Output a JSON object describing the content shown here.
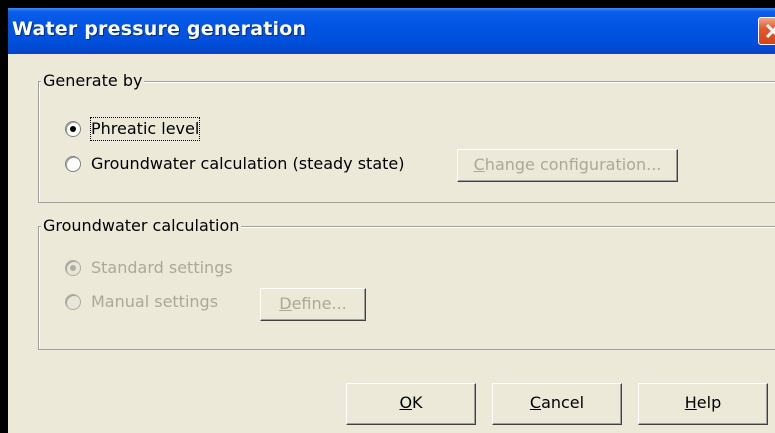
{
  "window": {
    "title": "Water pressure generation"
  },
  "generate_by": {
    "legend": "Generate by",
    "options": [
      {
        "label": "Phreatic level",
        "selected": true,
        "enabled": true
      },
      {
        "label": "Groundwater calculation (steady state)",
        "selected": false,
        "enabled": true
      }
    ],
    "change_config": {
      "mnemonic": "C",
      "rest": "hange configuration...",
      "enabled": false
    }
  },
  "groundwater": {
    "legend": "Groundwater calculation",
    "options": [
      {
        "label": "Standard settings",
        "selected": true,
        "enabled": false
      },
      {
        "label": "Manual settings",
        "selected": false,
        "enabled": false
      }
    ],
    "define": {
      "mnemonic": "D",
      "rest": "efine...",
      "enabled": false
    }
  },
  "footer": {
    "ok": {
      "mnemonic": "O",
      "rest": "K"
    },
    "cancel": {
      "mnemonic": "C",
      "rest": "ancel"
    },
    "help": {
      "mnemonic": "H",
      "rest": "elp"
    }
  },
  "icons": {
    "close": "close-icon"
  }
}
